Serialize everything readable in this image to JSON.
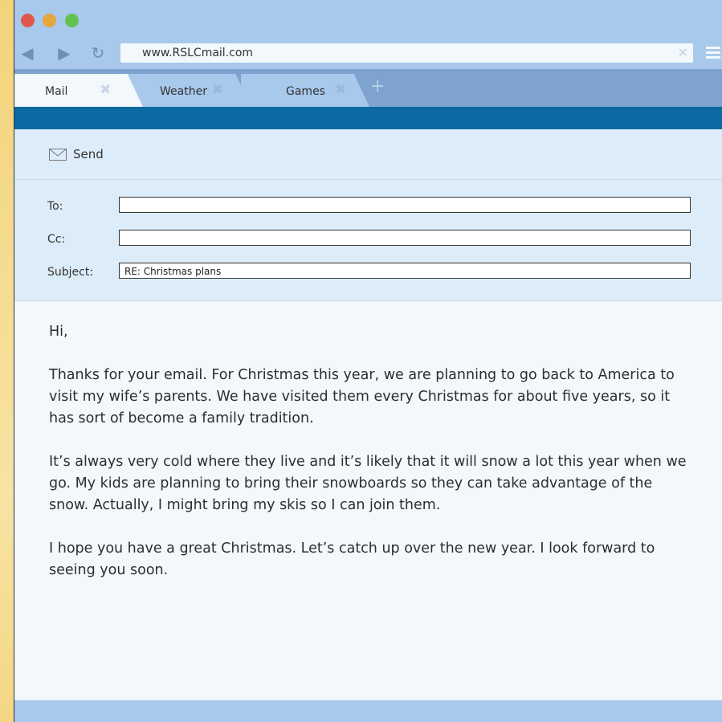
{
  "browser": {
    "url": "www.RSLCmail.com",
    "tabs": [
      {
        "label": "Mail"
      },
      {
        "label": "Weather"
      },
      {
        "label": "Games"
      }
    ]
  },
  "toolbar": {
    "send_label": "Send"
  },
  "headers": {
    "to_label": "To:",
    "to_value": "",
    "cc_label": "Cc:",
    "cc_value": "",
    "subject_label": "Subject:",
    "subject_value": "RE: Christmas plans"
  },
  "message": {
    "greeting": "Hi,",
    "paragraph1": "Thanks for your email. For Christmas this year, we are planning to go back to America to visit my wife’s parents. We have visited them every Christmas for about five years, so it has sort of become a family tradition.",
    "paragraph2": "It’s always very cold where they live and it’s likely that it will snow a lot this year when we go. My kids are planning to bring their snowboards so they can take advantage of the snow. Actually, I might bring my skis so I can join them.",
    "paragraph3": "I hope you have a great Christmas. Let’s catch up over the new year. I look forward to seeing you soon."
  },
  "colors": {
    "chrome": "#a8c8ec",
    "tabstrip": "#7fa3cf",
    "accent_bar": "#0a6aa1",
    "panel": "#dcecf8",
    "background": "#f3d37a"
  }
}
